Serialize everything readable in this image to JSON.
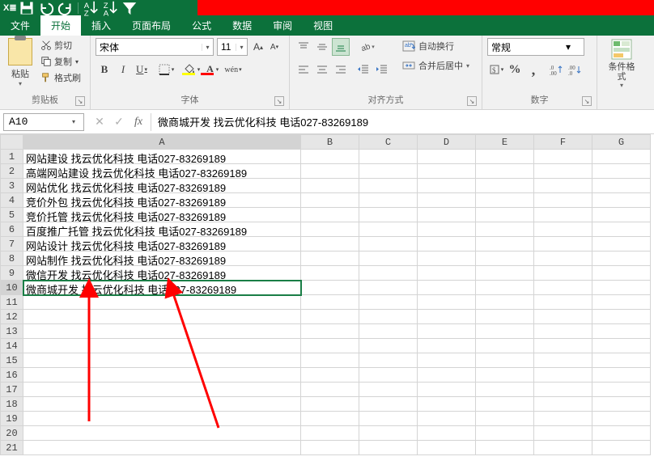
{
  "qat": {
    "excel_label": "X≣"
  },
  "tabs": {
    "file": "文件",
    "home": "开始",
    "insert": "插入",
    "page_layout": "页面布局",
    "formulas": "公式",
    "data": "数据",
    "review": "审阅",
    "view": "视图"
  },
  "ribbon": {
    "clipboard": {
      "paste": "粘贴",
      "cut": "剪切",
      "copy": "复制",
      "format_painter": "格式刷",
      "label": "剪贴板"
    },
    "font": {
      "name": "宋体",
      "size": "11",
      "bold": "B",
      "italic": "I",
      "underline": "U",
      "phonetic": "wén",
      "label": "字体"
    },
    "align": {
      "wrap": "自动换行",
      "merge": "合并后居中",
      "label": "对齐方式"
    },
    "number": {
      "format": "常规",
      "percent": "%",
      "comma": ",",
      "label": "数字"
    },
    "cond": {
      "label": "条件格式"
    }
  },
  "namebox": {
    "ref": "A10"
  },
  "formula_bar": {
    "value": "微商城开发  找云优化科技  电话027-83269189"
  },
  "columns": [
    "A",
    "B",
    "C",
    "D",
    "E",
    "F",
    "G"
  ],
  "rows": [
    {
      "n": 1,
      "a": "网站建设  找云优化科技  电话027-83269189"
    },
    {
      "n": 2,
      "a": "高端网站建设  找云优化科技  电话027-83269189"
    },
    {
      "n": 3,
      "a": "网站优化  找云优化科技  电话027-83269189"
    },
    {
      "n": 4,
      "a": "竞价外包  找云优化科技  电话027-83269189"
    },
    {
      "n": 5,
      "a": "竞价托管  找云优化科技  电话027-83269189"
    },
    {
      "n": 6,
      "a": "百度推广托管  找云优化科技  电话027-83269189"
    },
    {
      "n": 7,
      "a": "网站设计  找云优化科技  电话027-83269189"
    },
    {
      "n": 8,
      "a": "网站制作  找云优化科技  电话027-83269189"
    },
    {
      "n": 9,
      "a": "微信开发  找云优化科技  电话027-83269189"
    },
    {
      "n": 10,
      "a": "微商城开发  找云优化科技  电话027-83269189"
    },
    {
      "n": 11,
      "a": ""
    },
    {
      "n": 12,
      "a": ""
    },
    {
      "n": 13,
      "a": ""
    },
    {
      "n": 14,
      "a": ""
    },
    {
      "n": 15,
      "a": ""
    },
    {
      "n": 16,
      "a": ""
    },
    {
      "n": 17,
      "a": ""
    },
    {
      "n": 18,
      "a": ""
    },
    {
      "n": 19,
      "a": ""
    },
    {
      "n": 20,
      "a": ""
    },
    {
      "n": 21,
      "a": ""
    }
  ],
  "active": {
    "row": 10,
    "col": "A"
  }
}
